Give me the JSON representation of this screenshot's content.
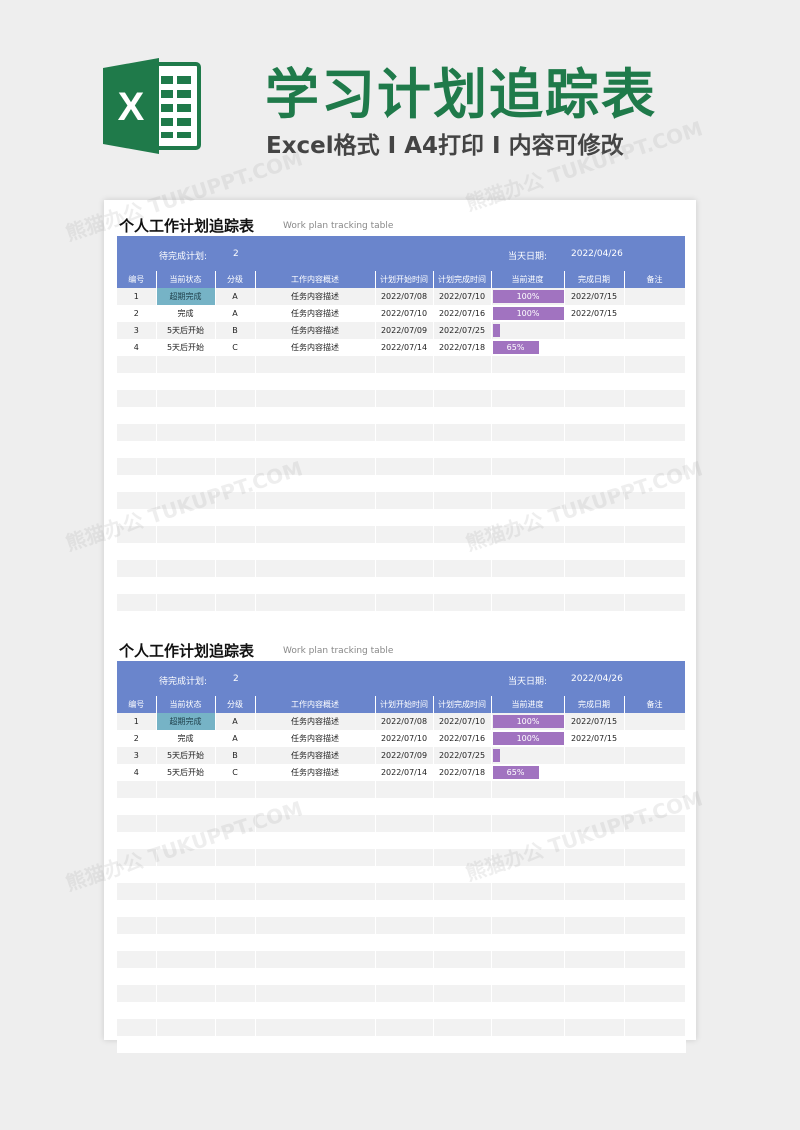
{
  "header": {
    "title": "学习计划追踪表",
    "subtitle": "Excel格式 I A4打印 I 内容可修改",
    "brand_color": "#1f7a4a"
  },
  "watermark": "熊猫办公 TUKUPPT.COM",
  "sheets": [
    {
      "title": "个人工作计划追踪表",
      "title_en": "Work plan tracking table",
      "pending_label": "待完成计划:",
      "pending_value": "2",
      "today_label": "当天日期:",
      "today_value": "2022/04/26",
      "columns": [
        "编号",
        "当前状态",
        "分级",
        "工作内容概述",
        "计划开始时间",
        "计划完成时间",
        "当前进度",
        "完成日期",
        "备注"
      ],
      "rows": [
        {
          "no": "1",
          "state": "超期完成",
          "level": "A",
          "desc": "任务内容描述",
          "start": "2022/07/08",
          "end": "2022/07/10",
          "progress": 100,
          "progress_label": "100%",
          "done": "2022/07/15",
          "note": ""
        },
        {
          "no": "2",
          "state": "完成",
          "level": "A",
          "desc": "任务内容描述",
          "start": "2022/07/10",
          "end": "2022/07/16",
          "progress": 100,
          "progress_label": "100%",
          "done": "2022/07/15",
          "note": ""
        },
        {
          "no": "3",
          "state": "5天后开始",
          "level": "B",
          "desc": "任务内容描述",
          "start": "2022/07/09",
          "end": "2022/07/25",
          "progress": 10,
          "progress_label": "",
          "done": "",
          "note": ""
        },
        {
          "no": "4",
          "state": "5天后开始",
          "level": "C",
          "desc": "任务内容描述",
          "start": "2022/07/14",
          "end": "2022/07/18",
          "progress": 65,
          "progress_label": "65%",
          "done": "",
          "note": ""
        }
      ]
    },
    {
      "title": "个人工作计划追踪表",
      "title_en": "Work plan tracking table",
      "pending_label": "待完成计划:",
      "pending_value": "2",
      "today_label": "当天日期:",
      "today_value": "2022/04/26",
      "columns": [
        "编号",
        "当前状态",
        "分级",
        "工作内容概述",
        "计划开始时间",
        "计划完成时间",
        "当前进度",
        "完成日期",
        "备注"
      ],
      "rows": [
        {
          "no": "1",
          "state": "超期完成",
          "level": "A",
          "desc": "任务内容描述",
          "start": "2022/07/08",
          "end": "2022/07/10",
          "progress": 100,
          "progress_label": "100%",
          "done": "2022/07/15",
          "note": ""
        },
        {
          "no": "2",
          "state": "完成",
          "level": "A",
          "desc": "任务内容描述",
          "start": "2022/07/10",
          "end": "2022/07/16",
          "progress": 100,
          "progress_label": "100%",
          "done": "2022/07/15",
          "note": ""
        },
        {
          "no": "3",
          "state": "5天后开始",
          "level": "B",
          "desc": "任务内容描述",
          "start": "2022/07/09",
          "end": "2022/07/25",
          "progress": 10,
          "progress_label": "",
          "done": "",
          "note": ""
        },
        {
          "no": "4",
          "state": "5天后开始",
          "level": "C",
          "desc": "任务内容描述",
          "start": "2022/07/14",
          "end": "2022/07/18",
          "progress": 65,
          "progress_label": "65%",
          "done": "",
          "note": ""
        }
      ]
    }
  ],
  "colors": {
    "header_blue": "#6a85cc",
    "progress_purple": "#a173c0",
    "overdue_teal": "#76b3c6"
  }
}
